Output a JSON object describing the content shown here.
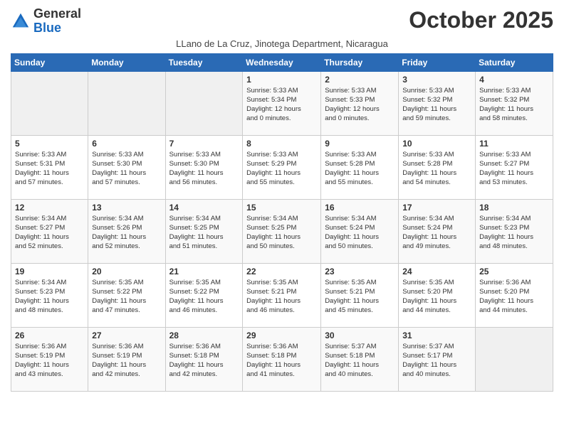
{
  "header": {
    "logo_general": "General",
    "logo_blue": "Blue",
    "month": "October 2025",
    "location": "LLano de La Cruz, Jinotega Department, Nicaragua"
  },
  "days_of_week": [
    "Sunday",
    "Monday",
    "Tuesday",
    "Wednesday",
    "Thursday",
    "Friday",
    "Saturday"
  ],
  "weeks": [
    [
      {
        "day": "",
        "info": ""
      },
      {
        "day": "",
        "info": ""
      },
      {
        "day": "",
        "info": ""
      },
      {
        "day": "1",
        "info": "Sunrise: 5:33 AM\nSunset: 5:34 PM\nDaylight: 12 hours\nand 0 minutes."
      },
      {
        "day": "2",
        "info": "Sunrise: 5:33 AM\nSunset: 5:33 PM\nDaylight: 12 hours\nand 0 minutes."
      },
      {
        "day": "3",
        "info": "Sunrise: 5:33 AM\nSunset: 5:32 PM\nDaylight: 11 hours\nand 59 minutes."
      },
      {
        "day": "4",
        "info": "Sunrise: 5:33 AM\nSunset: 5:32 PM\nDaylight: 11 hours\nand 58 minutes."
      }
    ],
    [
      {
        "day": "5",
        "info": "Sunrise: 5:33 AM\nSunset: 5:31 PM\nDaylight: 11 hours\nand 57 minutes."
      },
      {
        "day": "6",
        "info": "Sunrise: 5:33 AM\nSunset: 5:30 PM\nDaylight: 11 hours\nand 57 minutes."
      },
      {
        "day": "7",
        "info": "Sunrise: 5:33 AM\nSunset: 5:30 PM\nDaylight: 11 hours\nand 56 minutes."
      },
      {
        "day": "8",
        "info": "Sunrise: 5:33 AM\nSunset: 5:29 PM\nDaylight: 11 hours\nand 55 minutes."
      },
      {
        "day": "9",
        "info": "Sunrise: 5:33 AM\nSunset: 5:28 PM\nDaylight: 11 hours\nand 55 minutes."
      },
      {
        "day": "10",
        "info": "Sunrise: 5:33 AM\nSunset: 5:28 PM\nDaylight: 11 hours\nand 54 minutes."
      },
      {
        "day": "11",
        "info": "Sunrise: 5:33 AM\nSunset: 5:27 PM\nDaylight: 11 hours\nand 53 minutes."
      }
    ],
    [
      {
        "day": "12",
        "info": "Sunrise: 5:34 AM\nSunset: 5:27 PM\nDaylight: 11 hours\nand 52 minutes."
      },
      {
        "day": "13",
        "info": "Sunrise: 5:34 AM\nSunset: 5:26 PM\nDaylight: 11 hours\nand 52 minutes."
      },
      {
        "day": "14",
        "info": "Sunrise: 5:34 AM\nSunset: 5:25 PM\nDaylight: 11 hours\nand 51 minutes."
      },
      {
        "day": "15",
        "info": "Sunrise: 5:34 AM\nSunset: 5:25 PM\nDaylight: 11 hours\nand 50 minutes."
      },
      {
        "day": "16",
        "info": "Sunrise: 5:34 AM\nSunset: 5:24 PM\nDaylight: 11 hours\nand 50 minutes."
      },
      {
        "day": "17",
        "info": "Sunrise: 5:34 AM\nSunset: 5:24 PM\nDaylight: 11 hours\nand 49 minutes."
      },
      {
        "day": "18",
        "info": "Sunrise: 5:34 AM\nSunset: 5:23 PM\nDaylight: 11 hours\nand 48 minutes."
      }
    ],
    [
      {
        "day": "19",
        "info": "Sunrise: 5:34 AM\nSunset: 5:23 PM\nDaylight: 11 hours\nand 48 minutes."
      },
      {
        "day": "20",
        "info": "Sunrise: 5:35 AM\nSunset: 5:22 PM\nDaylight: 11 hours\nand 47 minutes."
      },
      {
        "day": "21",
        "info": "Sunrise: 5:35 AM\nSunset: 5:22 PM\nDaylight: 11 hours\nand 46 minutes."
      },
      {
        "day": "22",
        "info": "Sunrise: 5:35 AM\nSunset: 5:21 PM\nDaylight: 11 hours\nand 46 minutes."
      },
      {
        "day": "23",
        "info": "Sunrise: 5:35 AM\nSunset: 5:21 PM\nDaylight: 11 hours\nand 45 minutes."
      },
      {
        "day": "24",
        "info": "Sunrise: 5:35 AM\nSunset: 5:20 PM\nDaylight: 11 hours\nand 44 minutes."
      },
      {
        "day": "25",
        "info": "Sunrise: 5:36 AM\nSunset: 5:20 PM\nDaylight: 11 hours\nand 44 minutes."
      }
    ],
    [
      {
        "day": "26",
        "info": "Sunrise: 5:36 AM\nSunset: 5:19 PM\nDaylight: 11 hours\nand 43 minutes."
      },
      {
        "day": "27",
        "info": "Sunrise: 5:36 AM\nSunset: 5:19 PM\nDaylight: 11 hours\nand 42 minutes."
      },
      {
        "day": "28",
        "info": "Sunrise: 5:36 AM\nSunset: 5:18 PM\nDaylight: 11 hours\nand 42 minutes."
      },
      {
        "day": "29",
        "info": "Sunrise: 5:36 AM\nSunset: 5:18 PM\nDaylight: 11 hours\nand 41 minutes."
      },
      {
        "day": "30",
        "info": "Sunrise: 5:37 AM\nSunset: 5:18 PM\nDaylight: 11 hours\nand 40 minutes."
      },
      {
        "day": "31",
        "info": "Sunrise: 5:37 AM\nSunset: 5:17 PM\nDaylight: 11 hours\nand 40 minutes."
      },
      {
        "day": "",
        "info": ""
      }
    ]
  ]
}
